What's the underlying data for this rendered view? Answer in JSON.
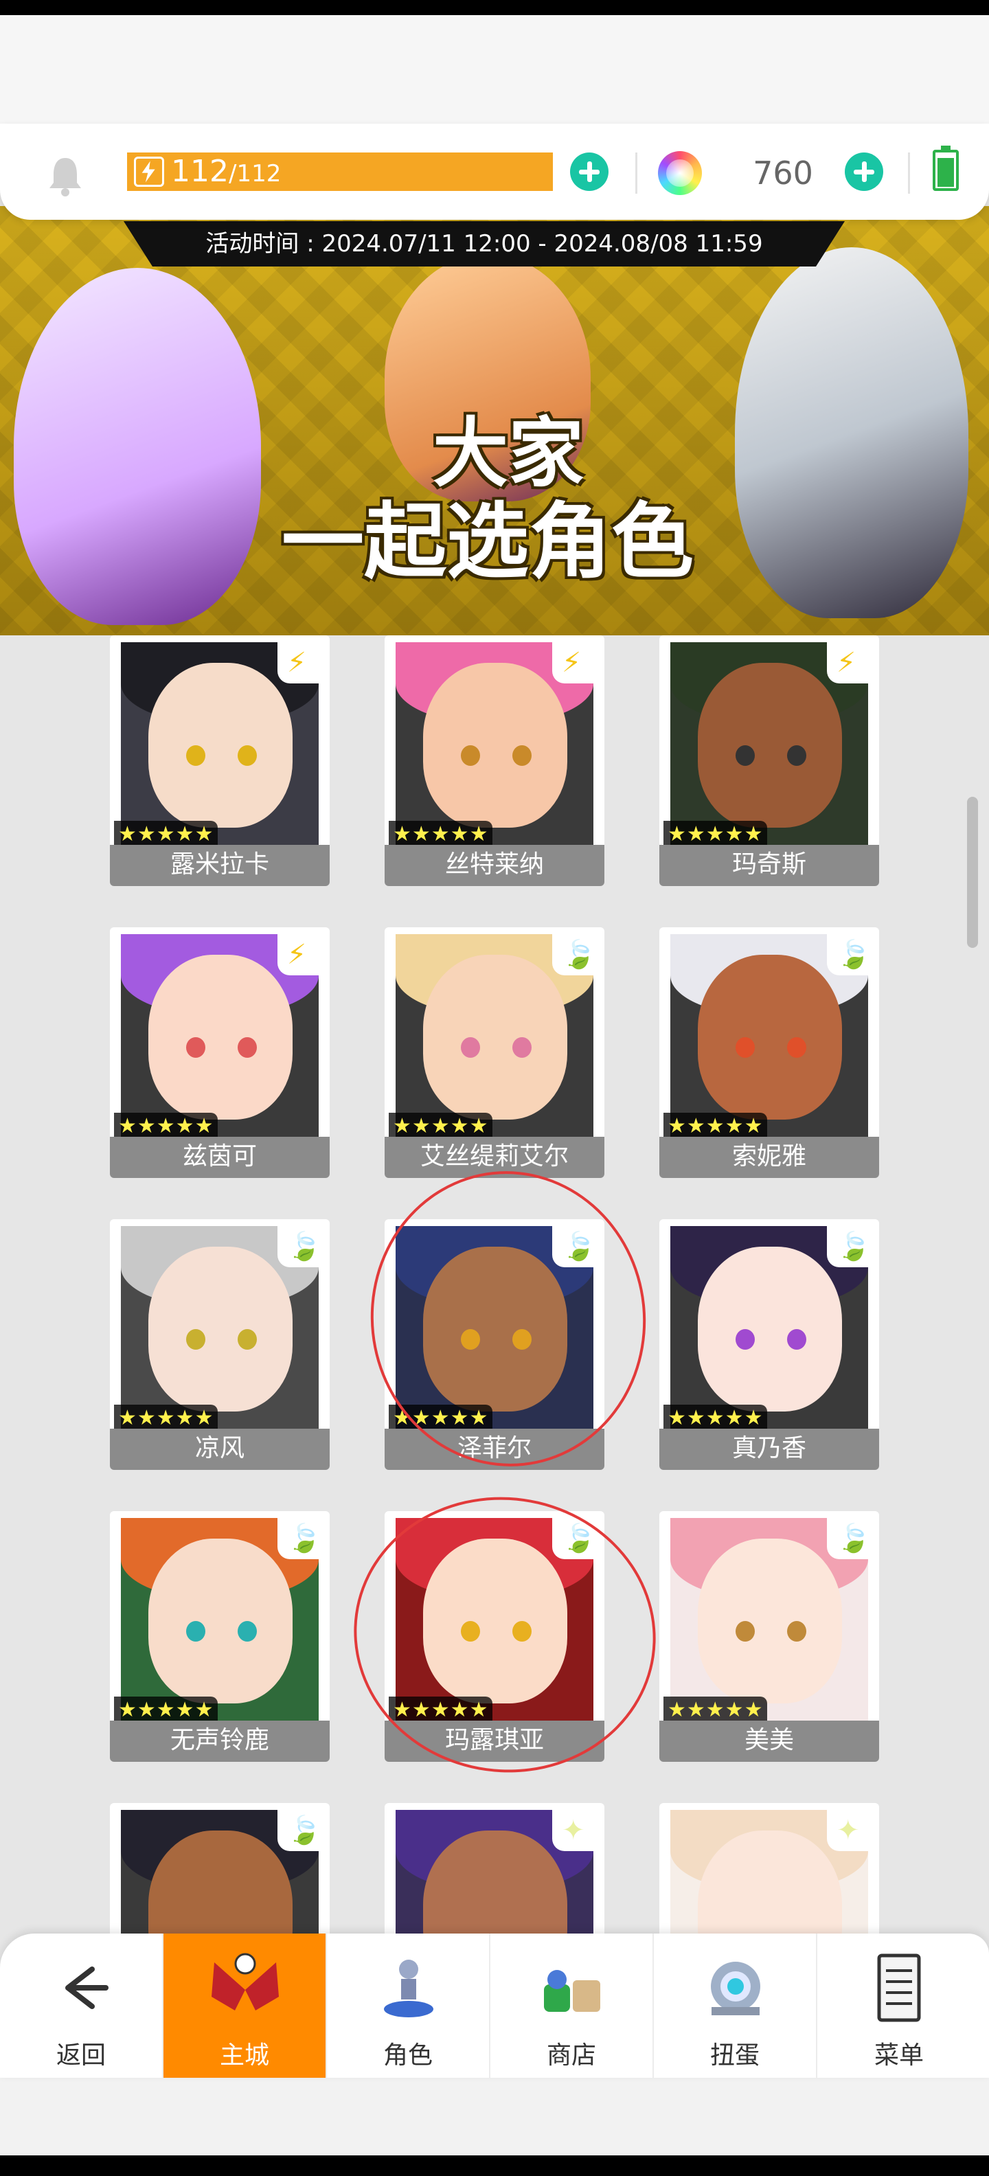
{
  "resources": {
    "stamina_current": "112",
    "stamina_max": "/112",
    "gems": "760"
  },
  "banner": {
    "event_time": "活动时间 : 2024.07/11 12:00 - 2024.08/08 11:59",
    "title_line1": "大家",
    "title_line2": "一起选角色"
  },
  "characters": [
    {
      "name": "露米拉卡",
      "element": "⚡",
      "stars": "★★★★★"
    },
    {
      "name": "丝特莱纳",
      "element": "⚡",
      "stars": "★★★★★"
    },
    {
      "name": "玛奇斯",
      "element": "⚡",
      "stars": "★★★★★"
    },
    {
      "name": "兹茵可",
      "element": "⚡",
      "stars": "★★★★★"
    },
    {
      "name": "艾丝缇莉艾尔",
      "element": "🍃",
      "stars": "★★★★★"
    },
    {
      "name": "索妮雅",
      "element": "🍃",
      "stars": "★★★★★"
    },
    {
      "name": "凉风",
      "element": "🍃",
      "stars": "★★★★★"
    },
    {
      "name": "泽菲尔",
      "element": "🍃",
      "stars": "★★★★★"
    },
    {
      "name": "真乃香",
      "element": "🍃",
      "stars": "★★★★★"
    },
    {
      "name": "无声铃鹿",
      "element": "🍃",
      "stars": "★★★★★"
    },
    {
      "name": "玛露琪亚",
      "element": "🍃",
      "stars": "★★★★★"
    },
    {
      "name": "美美",
      "element": "🍃",
      "stars": "★★★★★"
    },
    {
      "name": "",
      "element": "🍃",
      "stars": ""
    },
    {
      "name": "",
      "element": "✦",
      "stars": ""
    },
    {
      "name": "",
      "element": "✦",
      "stars": ""
    }
  ],
  "nav": {
    "back": "返回",
    "main": "主城",
    "role": "角色",
    "shop": "商店",
    "gacha": "扭蛋",
    "menu": "菜单"
  },
  "colors": {
    "accent_orange": "#ff8a00",
    "plus_teal": "#19c5a4",
    "stamina_bar": "#f5a623",
    "annotation_red": "#e23a3a"
  }
}
